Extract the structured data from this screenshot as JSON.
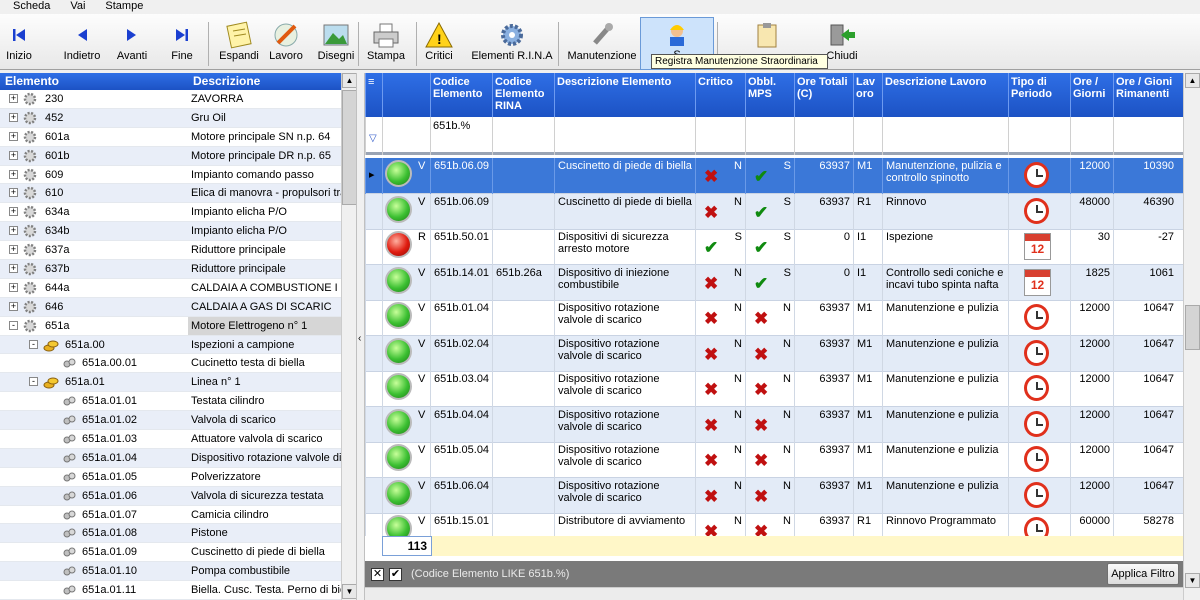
{
  "menu": [
    "Scheda",
    "Vai",
    "Stampe"
  ],
  "toolbar": [
    {
      "label": "Inizio",
      "icon": "first-icon"
    },
    {
      "label": "Indietro",
      "icon": "prev-icon"
    },
    {
      "label": "Avanti",
      "icon": "next-icon"
    },
    {
      "label": "Fine",
      "icon": "last-icon"
    },
    {
      "label": "Espandi",
      "icon": "notepad-icon"
    },
    {
      "label": "Lavoro",
      "icon": "pencil-icon"
    },
    {
      "label": "Disegni",
      "icon": "picture-icon"
    },
    {
      "label": "Stampa",
      "icon": "printer-icon"
    },
    {
      "label": "Critici",
      "icon": "warning-icon"
    },
    {
      "label": "Elementi R.I.N.A",
      "icon": "gear-icon"
    },
    {
      "label": "Manutenzione",
      "icon": "wrench-icon"
    },
    {
      "label": "S",
      "icon": "worker-icon"
    },
    {
      "label": "",
      "icon": "clipboard-icon"
    },
    {
      "label": "Chiudi",
      "icon": "exit-icon"
    }
  ],
  "tooltip": "Registra Manutenzione Straordinaria",
  "tree": {
    "headers": {
      "element": "Elemento",
      "description": "Descrizione"
    },
    "rows": [
      {
        "level": 0,
        "code": "230",
        "desc": "ZAVORRA",
        "expander": "+",
        "icon": "gear"
      },
      {
        "level": 0,
        "code": "452",
        "desc": "Gru Oil",
        "expander": "+",
        "icon": "gear"
      },
      {
        "level": 0,
        "code": "601a",
        "desc": "Motore principale SN n.p. 64",
        "expander": "+",
        "icon": "gear"
      },
      {
        "level": 0,
        "code": "601b",
        "desc": "Motore principale DR n.p. 65",
        "expander": "+",
        "icon": "gear"
      },
      {
        "level": 0,
        "code": "609",
        "desc": "Impianto comando passo",
        "expander": "+",
        "icon": "gear"
      },
      {
        "level": 0,
        "code": "610",
        "desc": "Elica di manovra - propulsori tra",
        "expander": "+",
        "icon": "gear"
      },
      {
        "level": 0,
        "code": "634a",
        "desc": "Impianto elicha P/O",
        "expander": "+",
        "icon": "gear"
      },
      {
        "level": 0,
        "code": "634b",
        "desc": "Impianto elicha P/O",
        "expander": "+",
        "icon": "gear"
      },
      {
        "level": 0,
        "code": "637a",
        "desc": "Riduttore principale",
        "expander": "+",
        "icon": "gear"
      },
      {
        "level": 0,
        "code": "637b",
        "desc": "Riduttore principale",
        "expander": "+",
        "icon": "gear"
      },
      {
        "level": 0,
        "code": "644a",
        "desc": "CALDAIA A COMBUSTIONE I",
        "expander": "+",
        "icon": "gear"
      },
      {
        "level": 0,
        "code": "646",
        "desc": "CALDAIA A GAS DI SCARIC",
        "expander": "+",
        "icon": "gear"
      },
      {
        "level": 0,
        "code": "651a",
        "desc": "Motore Elettrogeno n° 1",
        "expander": "-",
        "icon": "gear",
        "selected": true
      },
      {
        "level": 1,
        "code": "651a.00",
        "desc": "Ispezioni a campione",
        "expander": "-",
        "icon": "coins"
      },
      {
        "level": 2,
        "code": "651a.00.01",
        "desc": "Cucinetto testa di biella",
        "expander": "",
        "icon": "part"
      },
      {
        "level": 1,
        "code": "651a.01",
        "desc": "Linea n° 1",
        "expander": "-",
        "icon": "coins"
      },
      {
        "level": 2,
        "code": "651a.01.01",
        "desc": "Testata cilindro",
        "expander": "",
        "icon": "part"
      },
      {
        "level": 2,
        "code": "651a.01.02",
        "desc": "Valvola di scarico",
        "expander": "",
        "icon": "part"
      },
      {
        "level": 2,
        "code": "651a.01.03",
        "desc": "Attuatore valvola di scarico",
        "expander": "",
        "icon": "part"
      },
      {
        "level": 2,
        "code": "651a.01.04",
        "desc": "Dispositivo rotazione valvole di",
        "expander": "",
        "icon": "part"
      },
      {
        "level": 2,
        "code": "651a.01.05",
        "desc": "Polverizzatore",
        "expander": "",
        "icon": "part"
      },
      {
        "level": 2,
        "code": "651a.01.06",
        "desc": "Valvola di sicurezza testata",
        "expander": "",
        "icon": "part"
      },
      {
        "level": 2,
        "code": "651a.01.07",
        "desc": "Camicia cilindro",
        "expander": "",
        "icon": "part"
      },
      {
        "level": 2,
        "code": "651a.01.08",
        "desc": "Pistone",
        "expander": "",
        "icon": "part"
      },
      {
        "level": 2,
        "code": "651a.01.09",
        "desc": "Cuscinetto di piede di biella",
        "expander": "",
        "icon": "part"
      },
      {
        "level": 2,
        "code": "651a.01.10",
        "desc": "Pompa combustibile",
        "expander": "",
        "icon": "part"
      },
      {
        "level": 2,
        "code": "651a.01.11",
        "desc": "Biella. Cusc. Testa. Perno di bie",
        "expander": "",
        "icon": "part"
      }
    ]
  },
  "grid": {
    "columns": [
      {
        "key": "code",
        "label": "Codice Elemento"
      },
      {
        "key": "rina",
        "label": "Codice Elemento RINA"
      },
      {
        "key": "desc",
        "label": "Descrizione Elemento"
      },
      {
        "key": "critico",
        "label": "Critico"
      },
      {
        "key": "mps",
        "label": "Obbl. MPS"
      },
      {
        "key": "ore",
        "label": "Ore Totali (C)"
      },
      {
        "key": "lav",
        "label": "Lav oro"
      },
      {
        "key": "desclav",
        "label": "Descrizione Lavoro"
      },
      {
        "key": "tipo",
        "label": "Tipo di Periodo"
      },
      {
        "key": "oregiorni",
        "label": "Ore / Giorni"
      },
      {
        "key": "rim",
        "label": "Ore / Gioni Rimanenti"
      }
    ],
    "filter_code": "651b.%",
    "rows": [
      {
        "status": "V",
        "code": "651b.06.09",
        "rina": "",
        "desc": "Cuscinetto di piede di biella",
        "crit": "x",
        "critL": "N",
        "mps": "check",
        "mpsL": "S",
        "ore": "63937",
        "lav": "M1",
        "desclav": "Manutenzione, pulizia e controllo spinotto",
        "tipo": "clock",
        "oregiorni": "12000",
        "rim": "10390",
        "selected": true
      },
      {
        "status": "V",
        "code": "651b.06.09",
        "rina": "",
        "desc": "Cuscinetto di piede di biella",
        "crit": "x",
        "critL": "N",
        "mps": "check",
        "mpsL": "S",
        "ore": "63937",
        "lav": "R1",
        "desclav": "Rinnovo",
        "tipo": "clock",
        "oregiorni": "48000",
        "rim": "46390"
      },
      {
        "status": "R",
        "code": "651b.50.01",
        "rina": "",
        "desc": "Dispositivi di sicurezza arresto motore",
        "crit": "check",
        "critL": "S",
        "mps": "check",
        "mpsL": "S",
        "ore": "0",
        "lav": "I1",
        "desclav": "Ispezione",
        "tipo": "calendar",
        "oregiorni": "30",
        "rim": "-27"
      },
      {
        "status": "V",
        "code": "651b.14.01",
        "rina": "651b.26a",
        "desc": "Dispositivo di iniezione combustibile",
        "crit": "x",
        "critL": "N",
        "mps": "check",
        "mpsL": "S",
        "ore": "0",
        "lav": "I1",
        "desclav": "Controllo sedi coniche e incavi tubo spinta nafta",
        "tipo": "calendar",
        "oregiorni": "1825",
        "rim": "1061"
      },
      {
        "status": "V",
        "code": "651b.01.04",
        "rina": "",
        "desc": "Dispositivo rotazione valvole di scarico",
        "crit": "x",
        "critL": "N",
        "mps": "x",
        "mpsL": "N",
        "ore": "63937",
        "lav": "M1",
        "desclav": "Manutenzione e pulizia",
        "tipo": "clock",
        "oregiorni": "12000",
        "rim": "10647"
      },
      {
        "status": "V",
        "code": "651b.02.04",
        "rina": "",
        "desc": "Dispositivo rotazione valvole di scarico",
        "crit": "x",
        "critL": "N",
        "mps": "x",
        "mpsL": "N",
        "ore": "63937",
        "lav": "M1",
        "desclav": "Manutenzione e pulizia",
        "tipo": "clock",
        "oregiorni": "12000",
        "rim": "10647"
      },
      {
        "status": "V",
        "code": "651b.03.04",
        "rina": "",
        "desc": "Dispositivo rotazione valvole di scarico",
        "crit": "x",
        "critL": "N",
        "mps": "x",
        "mpsL": "N",
        "ore": "63937",
        "lav": "M1",
        "desclav": "Manutenzione e pulizia",
        "tipo": "clock",
        "oregiorni": "12000",
        "rim": "10647"
      },
      {
        "status": "V",
        "code": "651b.04.04",
        "rina": "",
        "desc": "Dispositivo rotazione valvole di scarico",
        "crit": "x",
        "critL": "N",
        "mps": "x",
        "mpsL": "N",
        "ore": "63937",
        "lav": "M1",
        "desclav": "Manutenzione e pulizia",
        "tipo": "clock",
        "oregiorni": "12000",
        "rim": "10647"
      },
      {
        "status": "V",
        "code": "651b.05.04",
        "rina": "",
        "desc": "Dispositivo rotazione valvole di scarico",
        "crit": "x",
        "critL": "N",
        "mps": "x",
        "mpsL": "N",
        "ore": "63937",
        "lav": "M1",
        "desclav": "Manutenzione e pulizia",
        "tipo": "clock",
        "oregiorni": "12000",
        "rim": "10647"
      },
      {
        "status": "V",
        "code": "651b.06.04",
        "rina": "",
        "desc": "Dispositivo rotazione valvole di scarico",
        "crit": "x",
        "critL": "N",
        "mps": "x",
        "mpsL": "N",
        "ore": "63937",
        "lav": "M1",
        "desclav": "Manutenzione e pulizia",
        "tipo": "clock",
        "oregiorni": "12000",
        "rim": "10647"
      },
      {
        "status": "V",
        "code": "651b.15.01",
        "rina": "",
        "desc": "Distributore di avviamento",
        "crit": "x",
        "critL": "N",
        "mps": "x",
        "mpsL": "N",
        "ore": "63937",
        "lav": "R1",
        "desclav": "Rinnovo Programmato",
        "tipo": "clock",
        "oregiorni": "60000",
        "rim": "58278"
      }
    ],
    "count": "113"
  },
  "filterbar": {
    "text": "(Codice Elemento LIKE 651b.%)",
    "checkbox_label": "✔",
    "clear_label": "✕",
    "apply": "Applica Filtro"
  }
}
